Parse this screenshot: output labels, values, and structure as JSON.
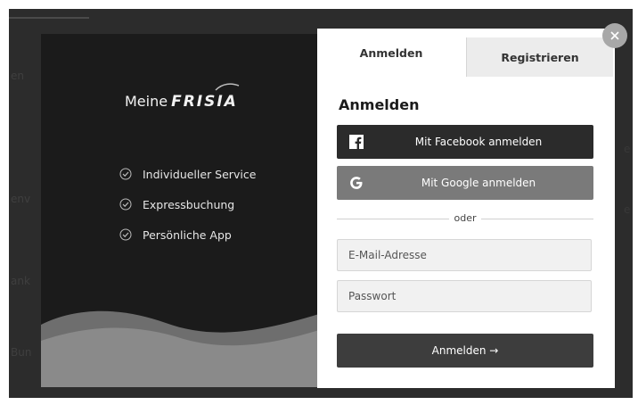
{
  "colors": {
    "backdrop": "#2c2c2c",
    "left_panel": "#1b1b1b",
    "facebook_button": "#2b2b2b",
    "google_button": "#7a7a7a",
    "submit_button": "#3d3d3d",
    "close_button": "#a8a8a8"
  },
  "brand": {
    "prefix": "Meine",
    "name": "FRISIA"
  },
  "features": [
    {
      "label": "Individueller Service",
      "icon": "check-circle-icon"
    },
    {
      "label": "Expressbuchung",
      "icon": "check-circle-icon"
    },
    {
      "label": "Persönliche App",
      "icon": "check-circle-icon"
    }
  ],
  "tabs": {
    "login": "Anmelden",
    "register": "Registrieren"
  },
  "form": {
    "title": "Anmelden",
    "facebook_label": "Mit Facebook anmelden",
    "google_label": "Mit Google anmelden",
    "divider": "oder",
    "email_placeholder": "E-Mail-Adresse",
    "password_placeholder": "Passwort",
    "submit_label": "Anmelden →"
  }
}
